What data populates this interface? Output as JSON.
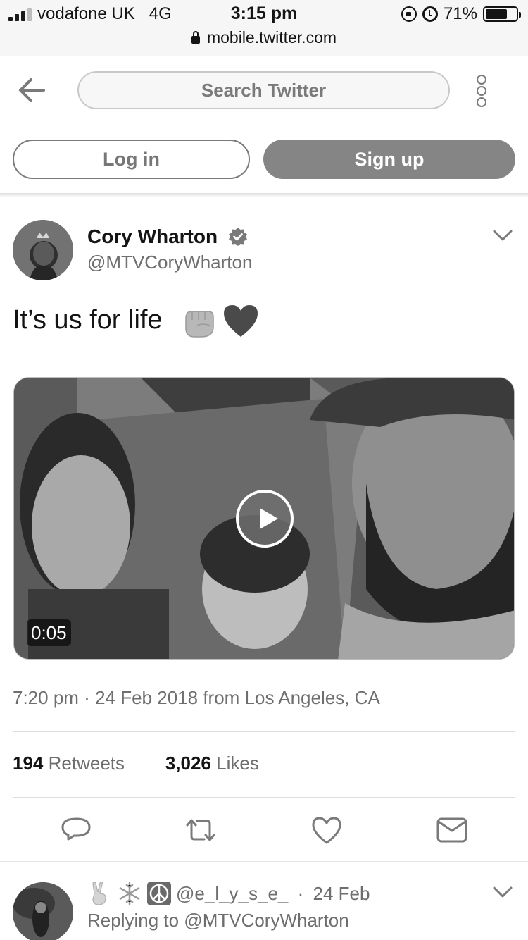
{
  "status_bar": {
    "carrier": "vodafone UK",
    "network": "4G",
    "time": "3:15 pm",
    "url": "mobile.twitter.com",
    "battery": "71%",
    "battery_level": 0.71
  },
  "header": {
    "back_icon": "arrow-left-icon",
    "search_placeholder": "Search Twitter",
    "more_icon": "vertical-dots-icon",
    "login_label": "Log in",
    "signup_label": "Sign up"
  },
  "tweet": {
    "author_name": "Cory Wharton",
    "handle": "@MTVCoryWharton",
    "verified": true,
    "text": "It’s us for life",
    "emojis": [
      "raised-fist-icon",
      "heart-icon"
    ],
    "video_duration": "0:05",
    "time": "7:20 pm",
    "date": "24 Feb 2018",
    "from_label": "from",
    "location": "Los Angeles, CA",
    "retweets_count": "194",
    "retweets_label": "Retweets",
    "likes_count": "3,026",
    "likes_label": "Likes",
    "actions": [
      "reply-icon",
      "retweet-icon",
      "like-icon",
      "message-icon"
    ]
  },
  "reply": {
    "handle": "@e_l_y_s_e_",
    "date": "24 Feb",
    "replying_to": "Replying to @MTVCoryWharton",
    "emojis": [
      "victory-hand-icon",
      "snowflake-icon",
      "peace-symbol-icon"
    ]
  },
  "colors": {
    "text_primary": "#141414",
    "text_secondary": "#6e6e6e",
    "signup_bg": "#858585"
  }
}
